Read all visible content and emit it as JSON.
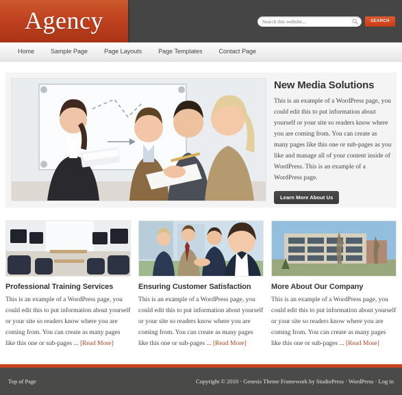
{
  "header": {
    "logo_text": "Agency",
    "search": {
      "placeholder": "Search this website...",
      "value": "",
      "button_label": "SEARCH"
    }
  },
  "nav": {
    "items": [
      {
        "label": "Home"
      },
      {
        "label": "Sample Page"
      },
      {
        "label": "Page Layouts"
      },
      {
        "label": "Page Templates"
      },
      {
        "label": "Contact Page"
      }
    ]
  },
  "hero": {
    "image_alt": "business team meeting at whiteboard",
    "title": "New Media Solutions",
    "paragraph": "This is an example of a WordPress page, you could edit this to put information about yourself or your site so readers know where you are coming from. You can create as many pages like this one or sub-pages as you like and manage all of your content inside of WordPress. This is an example of a WordPress page.",
    "button_label": "Learn More About Us"
  },
  "features": [
    {
      "image_alt": "computer training classroom",
      "title": "Professional Training Services",
      "body": "This is an example of a WordPress page, you could edit this to put information about yourself or your site so readers know where you are coming from. You can create as many pages like this one or sub-pages ... ",
      "read_more": "[Read More]"
    },
    {
      "image_alt": "business people shaking hands",
      "title": "Ensuring Customer Satisfaction",
      "body": "This is an example of a WordPress page, you could edit this to put information about yourself or your site so readers know where you are coming from. You can create as many pages like this one or sub-pages ... ",
      "read_more": "[Read More]"
    },
    {
      "image_alt": "modern office building exterior",
      "title": "More About Our Company",
      "body": "This is an example of a WordPress page, you could edit this to put information about yourself or your site so readers know where you are coming from. You can create as many pages like this one or sub-pages ... ",
      "read_more": "[Read More]"
    }
  ],
  "footer": {
    "top_of_page": "Top of Page",
    "copyright": "Copyright © 2010 · Genesis Theme Framework by StudioPress · WordPress · Log in"
  },
  "colors": {
    "brand_orange": "#c0411f",
    "search_button": "#d8471f",
    "header_dark": "#454545",
    "footer_dark": "#4a4a48",
    "footer_rule": "#c8441d",
    "link_orange": "#bf4020"
  }
}
